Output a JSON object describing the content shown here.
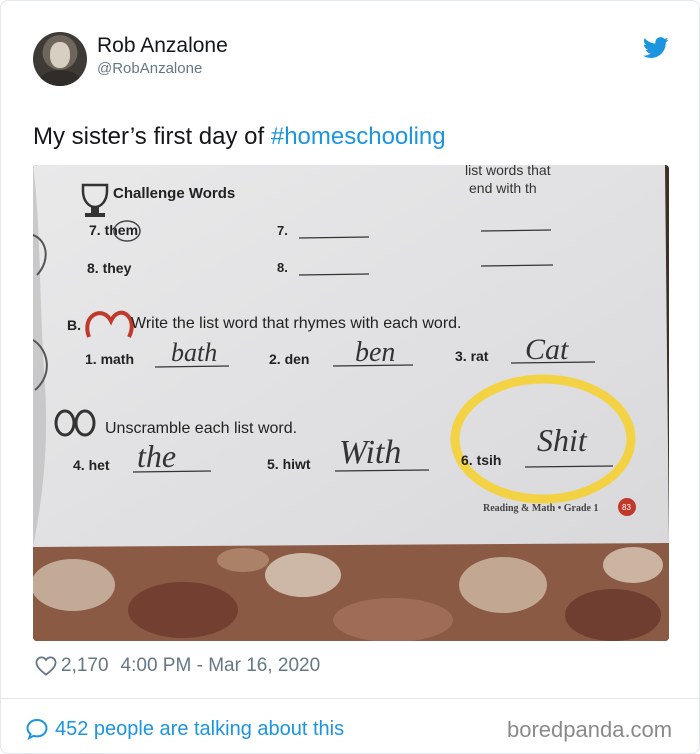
{
  "author": {
    "name": "Rob Anzalone",
    "handle": "@RobAnzalone",
    "avatar_icon": "profile-photo"
  },
  "tweet": {
    "text_prefix": "My sister’s first day of ",
    "hashtag": "#homeschooling"
  },
  "worksheet": {
    "header_right": [
      "list words that",
      "end with th"
    ],
    "challenge_title": "Challenge Words",
    "challenge_items": [
      "7. them",
      "8. they",
      "7.",
      "8."
    ],
    "section_b_label": "B.",
    "section_b_instruction": "Write the list word that rhymes with each word.",
    "rhyme_items": [
      {
        "prompt": "1. math",
        "answer": "bath"
      },
      {
        "prompt": "2. den",
        "answer": "ben"
      },
      {
        "prompt": "3. rat",
        "answer": "Cat"
      }
    ],
    "unscramble_instruction": "Unscramble each list word.",
    "unscramble_items": [
      {
        "prompt": "4. het",
        "answer": "the"
      },
      {
        "prompt": "5. hiwt",
        "answer": "With"
      },
      {
        "prompt": "6. tsih",
        "answer": "Shit"
      }
    ],
    "footer": "Reading & Math • Grade 1",
    "page_number": "83"
  },
  "meta": {
    "likes": "2,170",
    "timestamp": "4:00 PM - Mar 16, 2020"
  },
  "footer": {
    "talking": "452 people are talking about this",
    "watermark": "boredpanda.com"
  },
  "colors": {
    "twitter_blue": "#1b95e0",
    "text_primary": "#14171a",
    "text_secondary": "#657786",
    "highlight_yellow": "#f3d23a"
  }
}
